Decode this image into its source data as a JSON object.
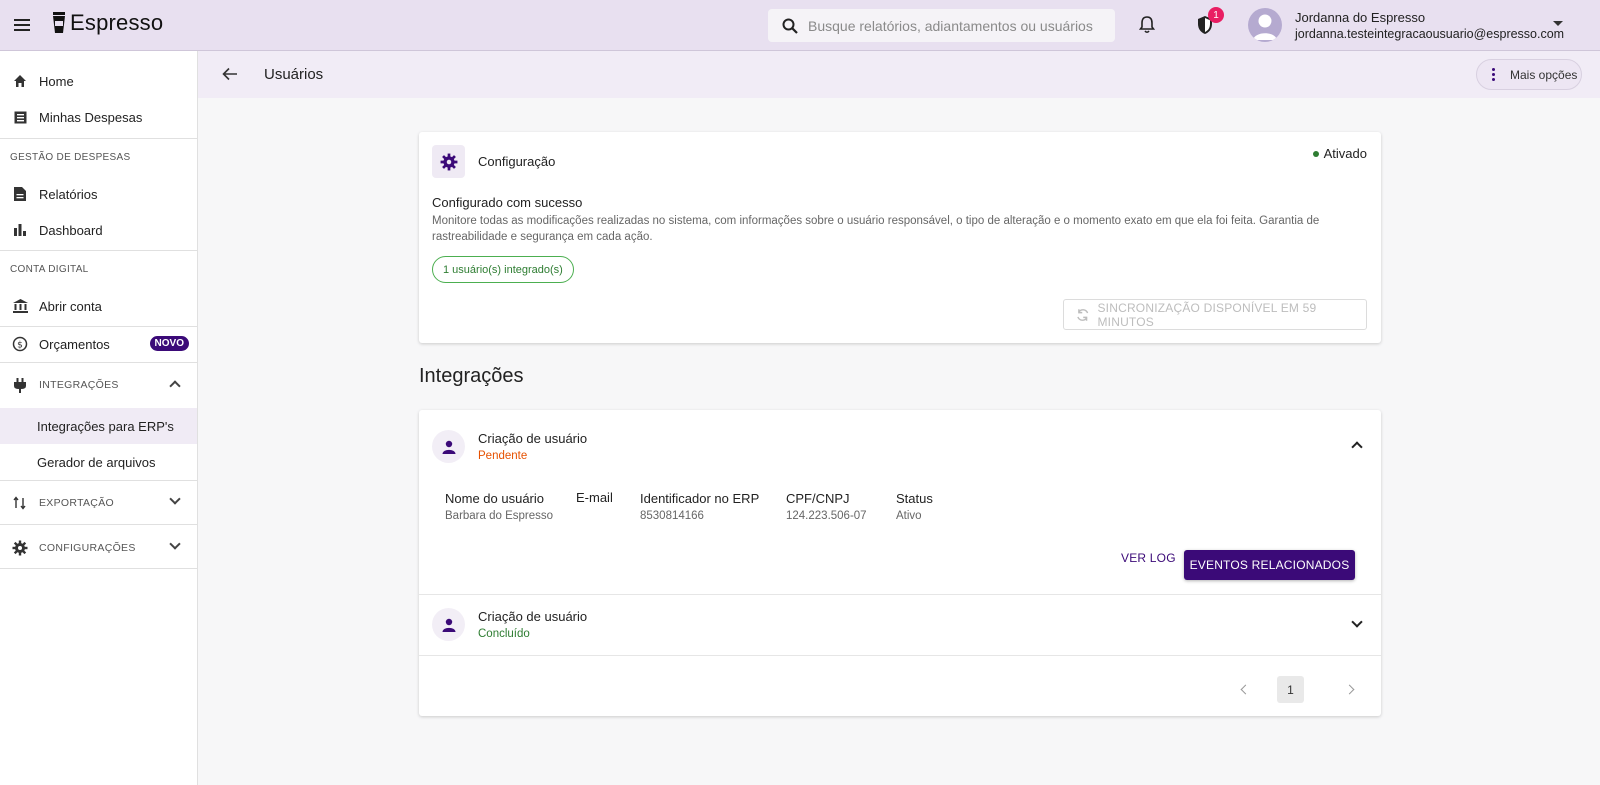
{
  "app": {
    "name": "Espresso"
  },
  "search": {
    "placeholder": "Busque relatórios, adiantamentos ou usuários"
  },
  "notifications": {
    "security_badge": "1"
  },
  "user": {
    "name": "Jordanna do Espresso",
    "email": "jordanna.testeintegracaousuario@espresso.com"
  },
  "sidebar": {
    "home": "Home",
    "minhas_despesas": "Minhas Despesas",
    "section_gestao": "GESTÃO DE DESPESAS",
    "relatorios": "Relatórios",
    "dashboard": "Dashboard",
    "section_conta": "CONTA DIGITAL",
    "abrir_conta": "Abrir conta",
    "orcamentos": "Orçamentos",
    "novo_badge": "NOVO",
    "integracoes": "INTEGRAÇÕES",
    "integracoes_erp": "Integrações para ERP's",
    "gerador_arquivos": "Gerador de arquivos",
    "exportacao": "EXPORTAÇÃO",
    "configuracoes": "CONFIGURAÇÕES"
  },
  "page": {
    "title": "Usuários",
    "more_options": "Mais opções"
  },
  "config": {
    "title": "Configuração",
    "status": "Ativado",
    "subtitle": "Configurado com sucesso",
    "description": "Monitore todas as modificações realizadas no sistema, com informações sobre o usuário responsável, o tipo de alteração e o momento exato em que ela foi feita. Garantia de rastreabilidade e segurança em cada ação.",
    "chip": "1 usuário(s) integrado(s)",
    "sync_button": "SINCRONIZAÇÃO DISPONÍVEL EM 59 MINUTOS"
  },
  "integrations": {
    "title": "Integrações",
    "items": [
      {
        "title": "Criação de usuário",
        "status": "Pendente",
        "columns": [
          "Nome do usuário",
          "E-mail",
          "Identificador no ERP",
          "CPF/CNPJ",
          "Status"
        ],
        "values": [
          "Barbara do Espresso",
          "",
          "8530814166",
          "124.223.506-07",
          "Ativo"
        ],
        "log_button": "VER LOG",
        "events_button": "EVENTOS RELACIONADOS"
      },
      {
        "title": "Criação de usuário",
        "status": "Concluído"
      }
    ],
    "page": "1"
  },
  "colors": {
    "accent": "#3b0a78",
    "pending": "#e65100",
    "done": "#2e7d32"
  }
}
